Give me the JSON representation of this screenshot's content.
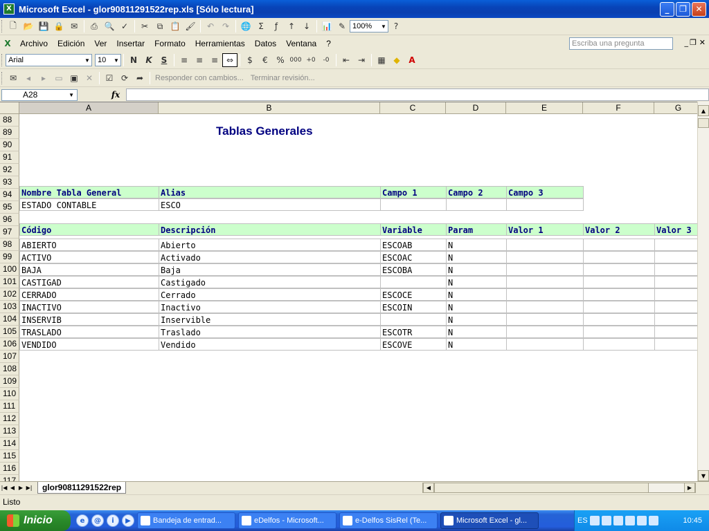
{
  "window": {
    "title": "Microsoft Excel - glor90811291522rep.xls  [Sólo lectura]"
  },
  "toolbar1": {
    "zoom": "100%"
  },
  "menu": [
    "Archivo",
    "Edición",
    "Ver",
    "Insertar",
    "Formato",
    "Herramientas",
    "Datos",
    "Ventana",
    "?"
  ],
  "ask_placeholder": "Escriba una pregunta",
  "format_toolbar": {
    "font": "Arial",
    "size": "10",
    "bold": "N",
    "italic": "K",
    "underline": "S"
  },
  "review_toolbar": {
    "reply": "Responder con cambios...",
    "end": "Terminar revisión..."
  },
  "formula": {
    "name_box": "A28",
    "fx": "fx"
  },
  "columns": [
    "A",
    "B",
    "C",
    "D",
    "E",
    "F",
    "G"
  ],
  "row_numbers": [
    "88",
    "89",
    "90",
    "91",
    "92",
    "93",
    "94",
    "95",
    "96",
    "97",
    "98",
    "99",
    "100",
    "101",
    "102",
    "103",
    "104",
    "105",
    "106",
    "107",
    "108",
    "109",
    "110",
    "111",
    "112",
    "113",
    "114",
    "115",
    "116",
    "117"
  ],
  "sheet_title": "Tablas Generales",
  "table_header": {
    "labels": [
      "Nombre Tabla General",
      "Alias",
      "Campo 1",
      "Campo 2",
      "Campo 3"
    ],
    "values": [
      "ESTADO CONTABLE",
      "ESCO",
      "",
      "",
      ""
    ]
  },
  "detail": {
    "headers": [
      "Código",
      "Descripción",
      "Variable",
      "Param",
      "Valor 1",
      "Valor 2",
      "Valor 3"
    ],
    "rows": [
      [
        "ABIERTO",
        "Abierto",
        "ESCOAB",
        "N"
      ],
      [
        "ACTIVO",
        "Activado",
        "ESCOAC",
        "N"
      ],
      [
        "BAJA",
        "Baja",
        "ESCOBA",
        "N"
      ],
      [
        "CASTIGAD",
        "Castigado",
        "",
        "N"
      ],
      [
        "CERRADO",
        "Cerrado",
        "ESCOCE",
        "N"
      ],
      [
        "INACTIVO",
        "Inactivo",
        "ESCOIN",
        "N"
      ],
      [
        "INSERVIB",
        "Inservible",
        "",
        "N"
      ],
      [
        "TRASLADO",
        "Traslado",
        "ESCOTR",
        "N"
      ],
      [
        "VENDIDO",
        "Vendido",
        "ESCOVE",
        "N"
      ]
    ]
  },
  "sheet_tab": "glor90811291522rep",
  "status": "Listo",
  "taskbar": {
    "start": "Inicio",
    "tasks": [
      "Bandeja de entrad...",
      "eDelfos - Microsoft...",
      "e-Delfos SisRel (Te...",
      "Microsoft Excel - gl..."
    ],
    "lang": "ES",
    "clock": "10:45"
  }
}
